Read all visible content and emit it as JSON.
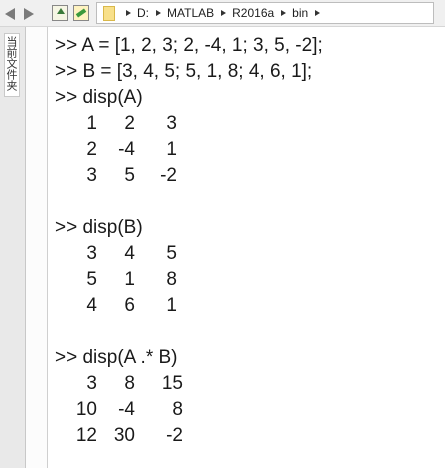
{
  "toolbar": {
    "back_icon": "back-arrow-icon",
    "forward_icon": "forward-arrow-icon",
    "up_icon": "up-folder-icon",
    "browse_icon": "browse-folder-icon",
    "path": [
      "D:",
      "MATLAB",
      "R2016a",
      "bin"
    ]
  },
  "sidebar": {
    "tab_label": "当前文件夹"
  },
  "console": {
    "cmd1": ">> A = [1, 2, 3; 2, -4, 1; 3, 5, -2];",
    "cmd2": ">> B = [3, 4, 5; 5, 1, 8; 4, 6, 1];",
    "cmd3": ">> disp(A)",
    "outA": [
      [
        "1",
        "2",
        "3"
      ],
      [
        "2",
        "-4",
        "1"
      ],
      [
        "3",
        "5",
        "-2"
      ]
    ],
    "cmd4": ">> disp(B)",
    "outB": [
      [
        "3",
        "4",
        "5"
      ],
      [
        "5",
        "1",
        "8"
      ],
      [
        "4",
        "6",
        "1"
      ]
    ],
    "cmd5": ">> disp(A .* B)",
    "outAB": [
      [
        "3",
        "8",
        "15"
      ],
      [
        "10",
        "-4",
        "8"
      ],
      [
        "12",
        "30",
        "-2"
      ]
    ]
  }
}
